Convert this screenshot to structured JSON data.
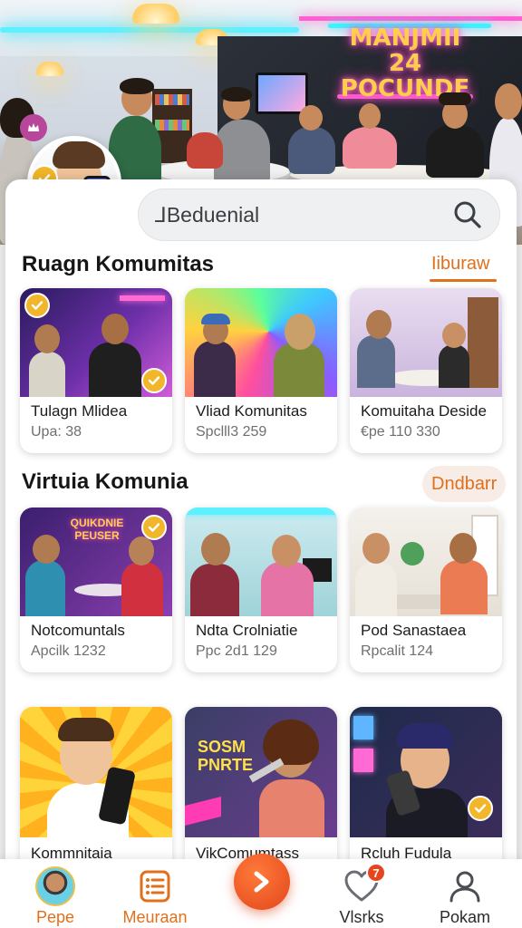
{
  "hero": {
    "neon_sign": "MANJMII 24 POCUNDE"
  },
  "search": {
    "value": "⅃Beduenial",
    "icon": "search-icon"
  },
  "section1": {
    "title": "Ruagn Komumitas",
    "link": "Iiburaw",
    "cards": [
      {
        "title": "Tulagn Mlidea",
        "meta": "Upa: 38"
      },
      {
        "title": "Vliad Komunitas",
        "meta": "Spclll3 259"
      },
      {
        "title": "Komuitaha Deside",
        "meta": "€pe 110 330"
      }
    ]
  },
  "section2": {
    "title": "Virtuia Komunia",
    "link": "Dndbarr",
    "cards": [
      {
        "title": "Notcomuntals",
        "meta": "Apcilk 1232",
        "sign": "QUIKDNIE PEUSER"
      },
      {
        "title": "Ndta Crolniatie",
        "meta": "Ppc 2d1 129"
      },
      {
        "title": "Pod Sanastaea",
        "meta": "Rpcalit 124"
      }
    ]
  },
  "section3": {
    "cards": [
      {
        "title": "Kommnitaia"
      },
      {
        "title": "VikComumtass",
        "poster": "SOSM PNRTE"
      },
      {
        "title": "Rcluh Fudula"
      }
    ]
  },
  "nav": {
    "items": [
      {
        "label": "Pepe",
        "icon": "profile-avatar-icon"
      },
      {
        "label": "Meuraan",
        "icon": "list-icon"
      },
      {
        "label": "",
        "icon": "forward-arrow-icon"
      },
      {
        "label": "Vlsrks",
        "icon": "heart-icon",
        "badge": "7"
      },
      {
        "label": "Pokam",
        "icon": "user-icon"
      }
    ]
  },
  "colors": {
    "accent": "#e0701c",
    "badge_yellow": "#f1b62a",
    "nav_center": "#e2461a"
  }
}
